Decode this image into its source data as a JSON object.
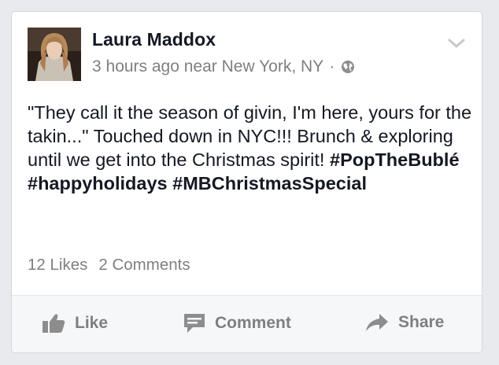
{
  "post": {
    "author": "Laura Maddox",
    "time": "3 hours ago near New York, NY",
    "separator": "·",
    "text_plain": "\"They call it the season of givin, I'm here, yours for the takin...\" Touched down in NYC!!! Brunch & exploring until we get into the Christmas spirit! ",
    "hashtags": [
      "#PopTheBublé",
      "#happyholidays",
      "#MBChristmasSpecial"
    ],
    "icons": {
      "privacy": "globe-icon",
      "menu": "chevron-down-icon"
    }
  },
  "stats": {
    "likes": "12 Likes",
    "comments": "2 Comments"
  },
  "actions": {
    "like": "Like",
    "comment": "Comment",
    "share": "Share"
  },
  "colors": {
    "background": "#e9eaed",
    "card": "#ffffff",
    "text": "#141823",
    "muted": "#7f7f7f",
    "action_bar": "#f6f7f8"
  }
}
